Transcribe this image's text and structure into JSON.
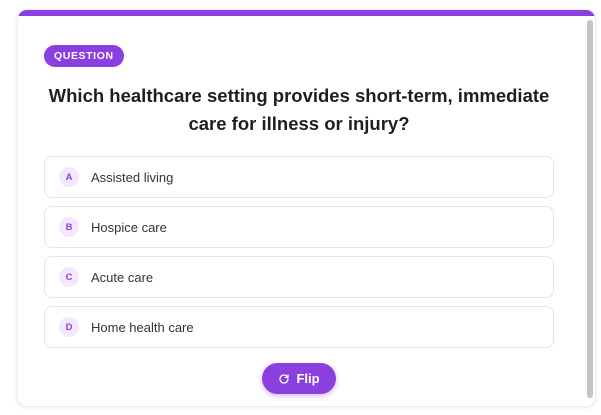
{
  "card": {
    "badge": "QUESTION",
    "question": "Which healthcare setting provides short-term, immediate care for illness or injury?",
    "accent_color": "#8b3fe0"
  },
  "options": [
    {
      "letter": "A",
      "text": "Assisted living"
    },
    {
      "letter": "B",
      "text": "Hospice care"
    },
    {
      "letter": "C",
      "text": "Acute care"
    },
    {
      "letter": "D",
      "text": "Home health care"
    }
  ],
  "flip_button": {
    "label": "Flip",
    "icon": "rotate-icon"
  }
}
